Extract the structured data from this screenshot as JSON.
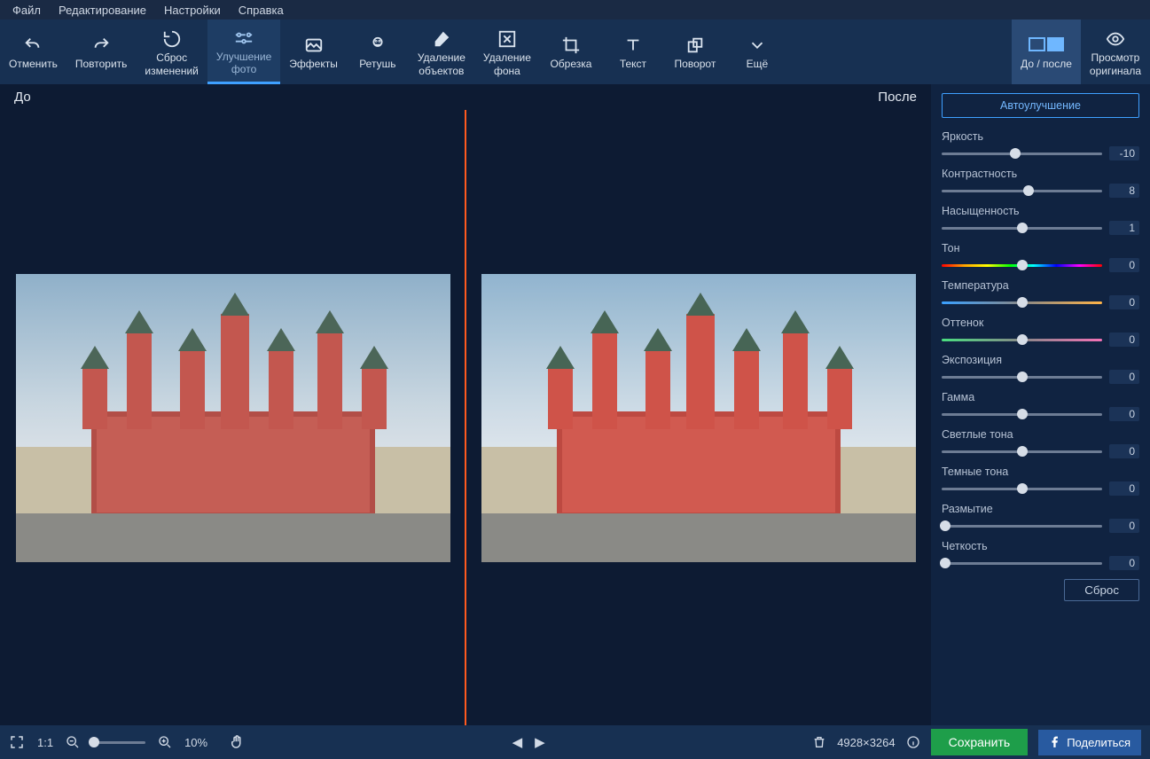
{
  "menubar": {
    "file": "Файл",
    "edit": "Редактирование",
    "settings": "Настройки",
    "help": "Справка"
  },
  "toolbar": {
    "undo": "Отменить",
    "redo": "Повторить",
    "reset": "Сброс\nизменений",
    "enhance": "Улучшение\nфото",
    "effects": "Эффекты",
    "retouch": "Ретушь",
    "remove_obj": "Удаление\nобъектов",
    "remove_bg": "Удаление\nфона",
    "crop": "Обрезка",
    "text": "Текст",
    "rotate": "Поворот",
    "more": "Ещё",
    "before_after": "До / после",
    "view_original": "Просмотр\nоригинала"
  },
  "canvas": {
    "before": "До",
    "after": "После"
  },
  "panel": {
    "auto": "Автоулучшение",
    "sliders": [
      {
        "label": "Яркость",
        "value": -10,
        "pos": 46,
        "track": ""
      },
      {
        "label": "Контрастность",
        "value": 8,
        "pos": 54,
        "track": ""
      },
      {
        "label": "Насыщенность",
        "value": 1,
        "pos": 50,
        "track": ""
      },
      {
        "label": "Тон",
        "value": 0,
        "pos": 50,
        "track": "hue"
      },
      {
        "label": "Температура",
        "value": 0,
        "pos": 50,
        "track": "temp"
      },
      {
        "label": "Оттенок",
        "value": 0,
        "pos": 50,
        "track": "tint"
      },
      {
        "label": "Экспозиция",
        "value": 0,
        "pos": 50,
        "track": ""
      },
      {
        "label": "Гамма",
        "value": 0,
        "pos": 50,
        "track": ""
      },
      {
        "label": "Светлые тона",
        "value": 0,
        "pos": 50,
        "track": ""
      },
      {
        "label": "Темные тона",
        "value": 0,
        "pos": 50,
        "track": ""
      },
      {
        "label": "Размытие",
        "value": 0,
        "pos": 2,
        "track": ""
      },
      {
        "label": "Четкость",
        "value": 0,
        "pos": 2,
        "track": ""
      }
    ],
    "reset": "Сброс"
  },
  "statusbar": {
    "fit": "1:1",
    "zoom_pct": "10%",
    "dims": "4928×3264",
    "save": "Сохранить",
    "share": "Поделиться"
  }
}
